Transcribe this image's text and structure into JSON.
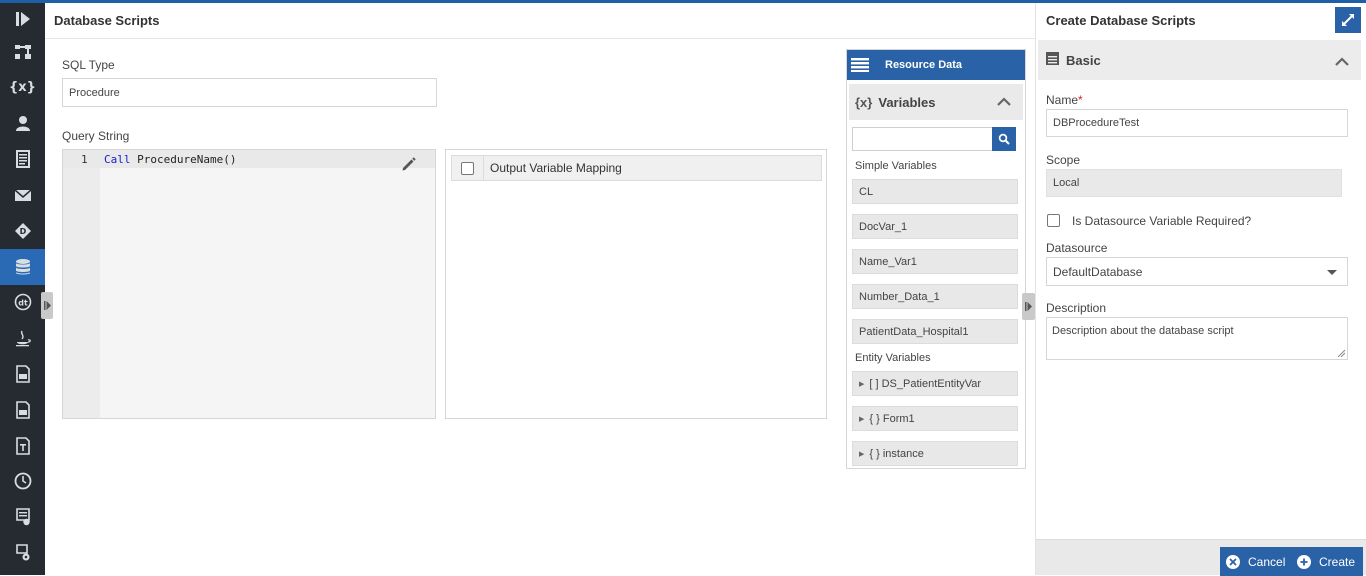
{
  "header": {
    "title": "Database Scripts"
  },
  "form": {
    "sql_type_label": "SQL Type",
    "sql_type_value": "Procedure",
    "query_label": "Query String",
    "code_line_number": "1",
    "code_keyword": "Call",
    "code_rest": " ProcedureName()"
  },
  "mapping": {
    "header": "Output Variable Mapping"
  },
  "resource": {
    "title": "Resource Data",
    "variables_icon": "{x}",
    "variables_title": "Variables",
    "search_placeholder": "",
    "simple_label": "Simple Variables",
    "simple_items": [
      "CL",
      "DocVar_1",
      "Name_Var1",
      "Number_Data_1",
      "PatientData_Hospital1"
    ],
    "entity_label": "Entity Variables",
    "entity_items": [
      "[ ] DS_PatientEntityVar",
      "{ } Form1",
      "{ } instance"
    ]
  },
  "right": {
    "title": "Create Database Scripts",
    "section": "Basic",
    "name_label": "Name",
    "name_required": "*",
    "name_value": "DBProcedureTest",
    "scope_label": "Scope",
    "scope_value": "Local",
    "ds_required_label": "Is Datasource Variable Required?",
    "datasource_label": "Datasource",
    "datasource_value": "DefaultDatabase",
    "description_label": "Description",
    "description_value": "Description about the database script",
    "cancel_label": "Cancel",
    "create_label": "Create"
  },
  "rail": {
    "icons": [
      "play-icon",
      "hierarchy-icon",
      "variables-icon",
      "user-icon",
      "document-icon",
      "mail-icon",
      "diamond-icon",
      "database-icon",
      "dt-icon",
      "java-icon",
      "js-file-icon",
      "css-file-icon",
      "text-template-icon",
      "clock-icon",
      "report-icon",
      "settings-icon"
    ],
    "variables_glyph": "{x}",
    "active_icon": "database-icon"
  },
  "colors": {
    "accent": "#2a62a8",
    "rail": "#252b31",
    "active": "#2a6ab5",
    "required": "#d9232e"
  }
}
